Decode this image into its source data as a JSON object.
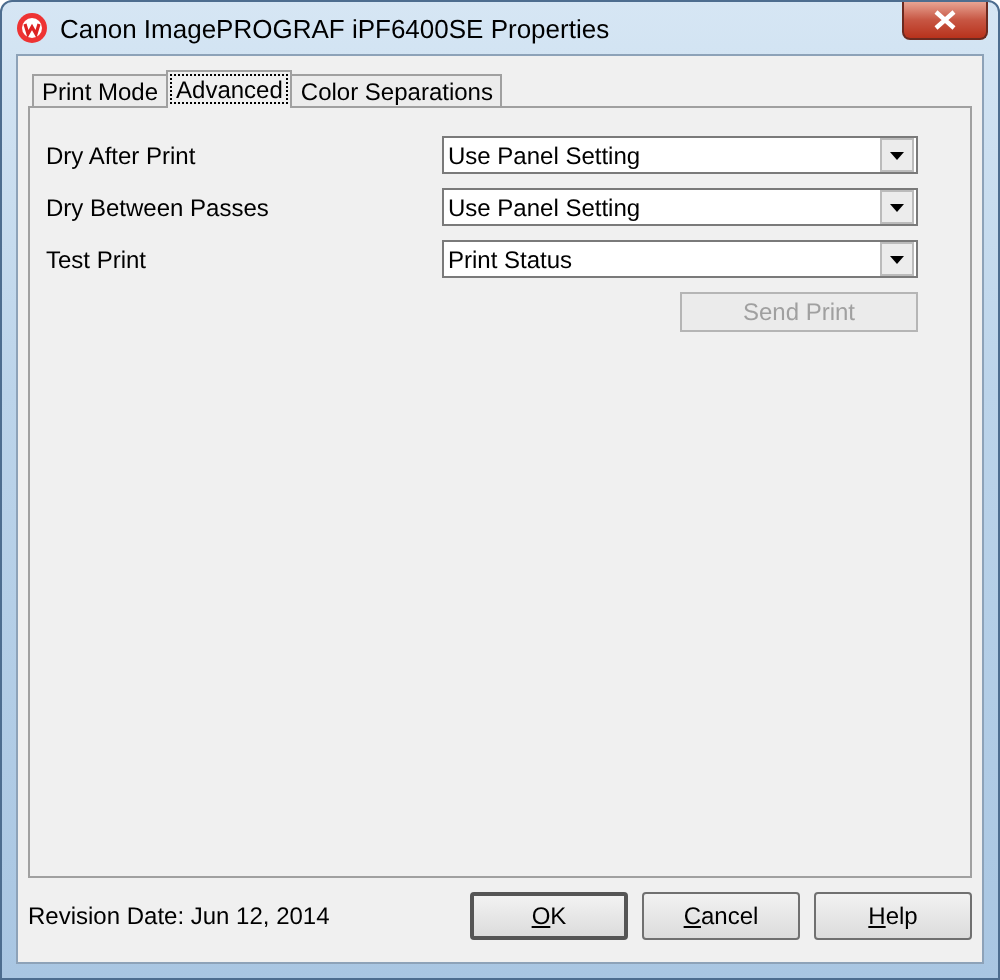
{
  "window": {
    "title": "Canon ImagePROGRAF iPF6400SE Properties"
  },
  "tabs": [
    {
      "label": "Print Mode",
      "selected": false
    },
    {
      "label": "Advanced",
      "selected": true
    },
    {
      "label": "Color Separations",
      "selected": false
    }
  ],
  "settings": [
    {
      "label": "Dry After Print",
      "value": "Use Panel Setting"
    },
    {
      "label": "Dry Between Passes",
      "value": "Use Panel Setting"
    },
    {
      "label": "Test Print",
      "value": "Print Status"
    }
  ],
  "send_print": {
    "label": "Send Print",
    "disabled": true
  },
  "revision": "Revision Date: Jun 12, 2014",
  "buttons": [
    {
      "accel": "O",
      "rest": "K",
      "default": true
    },
    {
      "accel": "C",
      "rest": "ancel",
      "default": false
    },
    {
      "accel": "H",
      "rest": "elp",
      "default": false
    }
  ]
}
